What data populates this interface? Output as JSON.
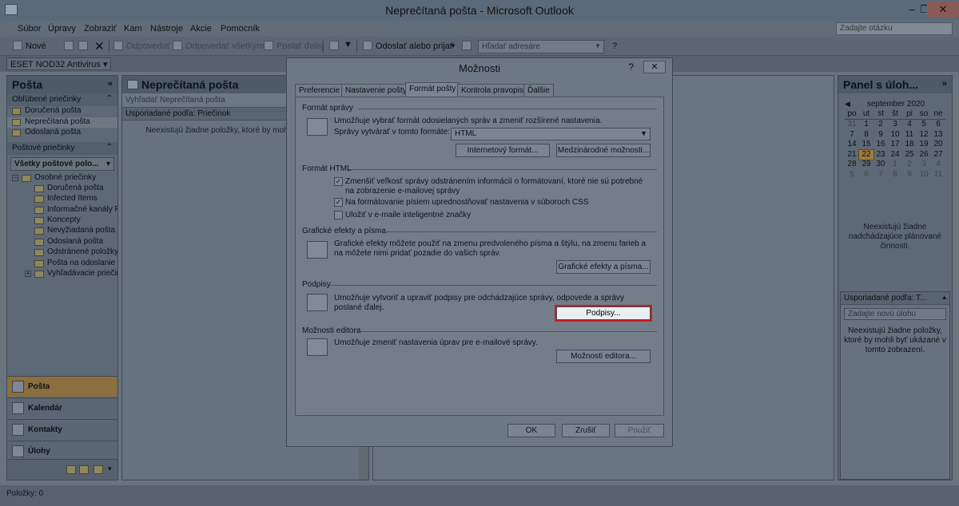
{
  "window": {
    "title": "Neprečítaná pošta - Microsoft Outlook"
  },
  "menu": [
    "Súbor",
    "Úpravy",
    "Zobraziť",
    "Kam",
    "Nástroje",
    "Akcie",
    "Pomocník"
  ],
  "ask_placeholder": "Zadajte otázku",
  "toolbar": {
    "new": "Nové",
    "reply": "Odpovedať",
    "reply_all": "Odpovedať všetkým",
    "forward": "Poslať ďalej",
    "send_receive": "Odoslať alebo prijať",
    "find_address": "Hľadať adresáre"
  },
  "eset": "ESET NOD32 Antivirus",
  "nav": {
    "title": "Pošta",
    "favorites_title": "Obľúbené priečinky",
    "favorites": [
      "Doručená pošta",
      "Neprečítaná pošta",
      "Odoslaná pošta"
    ],
    "mail_folders_title": "Poštové priečinky",
    "all_mail": "Všetky poštové polo...",
    "root": "Osobné priečinky",
    "folders": [
      "Doručená pošta",
      "Infected Items",
      "Informačné kanály R",
      "Koncepty",
      "Nevyžiadaná pošta",
      "Odoslaná pošta",
      "Odstránené položky",
      "Pošta na odoslanie",
      "Vyhľadávacie priečin"
    ],
    "buttons": [
      "Pošta",
      "Kalendár",
      "Kontakty",
      "Úlohy"
    ]
  },
  "list": {
    "title": "Neprečítaná pošta",
    "search_placeholder": "Vyhľadať Neprečítaná pošta",
    "arranged": "Usporiadané podľa: Priečinok",
    "empty": "Neexistujú žiadne položky, ktoré by mohli byť zobrazení."
  },
  "task": {
    "title": "Panel s úloh...",
    "month": "september 2020",
    "days_of_week": [
      "po",
      "ut",
      "st",
      "št",
      "pi",
      "so",
      "ne"
    ],
    "weeks": [
      [
        "31",
        "1",
        "2",
        "3",
        "4",
        "5",
        "6"
      ],
      [
        "7",
        "8",
        "9",
        "10",
        "11",
        "12",
        "13"
      ],
      [
        "14",
        "15",
        "16",
        "17",
        "18",
        "19",
        "20"
      ],
      [
        "21",
        "22",
        "23",
        "24",
        "25",
        "26",
        "27"
      ],
      [
        "28",
        "29",
        "30",
        "1",
        "2",
        "3",
        "4"
      ],
      [
        "5",
        "6",
        "7",
        "8",
        "9",
        "10",
        "11"
      ]
    ],
    "today": "22",
    "empty_activities": "Neexistujú žiadne nadchádzajúce plánované činnosti.",
    "arranged": "Usporiadané podľa: T...",
    "new_task_placeholder": "Zadajte novú úlohu",
    "empty_tasks": "Neexistujú žiadne položky, ktoré by mohli byť ukázané v tomto zobrazení."
  },
  "status": "Položky: 0",
  "dialog": {
    "title": "Možnosti",
    "help": "?",
    "tabs": [
      "Preferencie",
      "Nastavenie pošty",
      "Formát pošty",
      "Kontrola pravopisu",
      "Ďalšie"
    ],
    "message_format": {
      "title": "Formát správy",
      "desc": "Umožňuje vybrať formát odosielaných správ a zmeniť rozšírené nastavenia.",
      "compose_label": "Správy vytvárať v tomto formáte:",
      "compose_value": "HTML",
      "internet_btn": "Internetový formát...",
      "intl_btn": "Medzinárodné možnosti..."
    },
    "html_format": {
      "title": "Formát HTML",
      "opt1": "Zmenšiť veľkosť správy odstránením informácií o formátovaní, ktoré nie sú potrebné na zobrazenie e-mailovej správy",
      "opt2": "Na formátovanie písiem uprednostňovať nastavenia v súboroch CSS",
      "opt3": "Uložiť v e-maile inteligentné značky"
    },
    "stationery": {
      "title": "Grafické efekty a písma",
      "desc": "Grafické efekty môžete použiť na zmenu predvoleného písma a štýlu, na zmenu farieb a na môžete nimi pridať pozadie do vašich správ.",
      "btn": "Grafické efekty a písma..."
    },
    "signatures": {
      "title": "Podpisy",
      "desc": "Umožňuje vytvoriť a upraviť podpisy pre odchádzajúce správy, odpovede a správy poslané ďalej.",
      "btn": "Podpisy..."
    },
    "editor": {
      "title": "Možnosti editora",
      "desc": "Umožňuje zmeniť nastavenia úprav pre e-mailové správy.",
      "btn": "Možnosti editora..."
    },
    "ok": "OK",
    "cancel": "Zrušiť",
    "apply": "Použiť"
  }
}
